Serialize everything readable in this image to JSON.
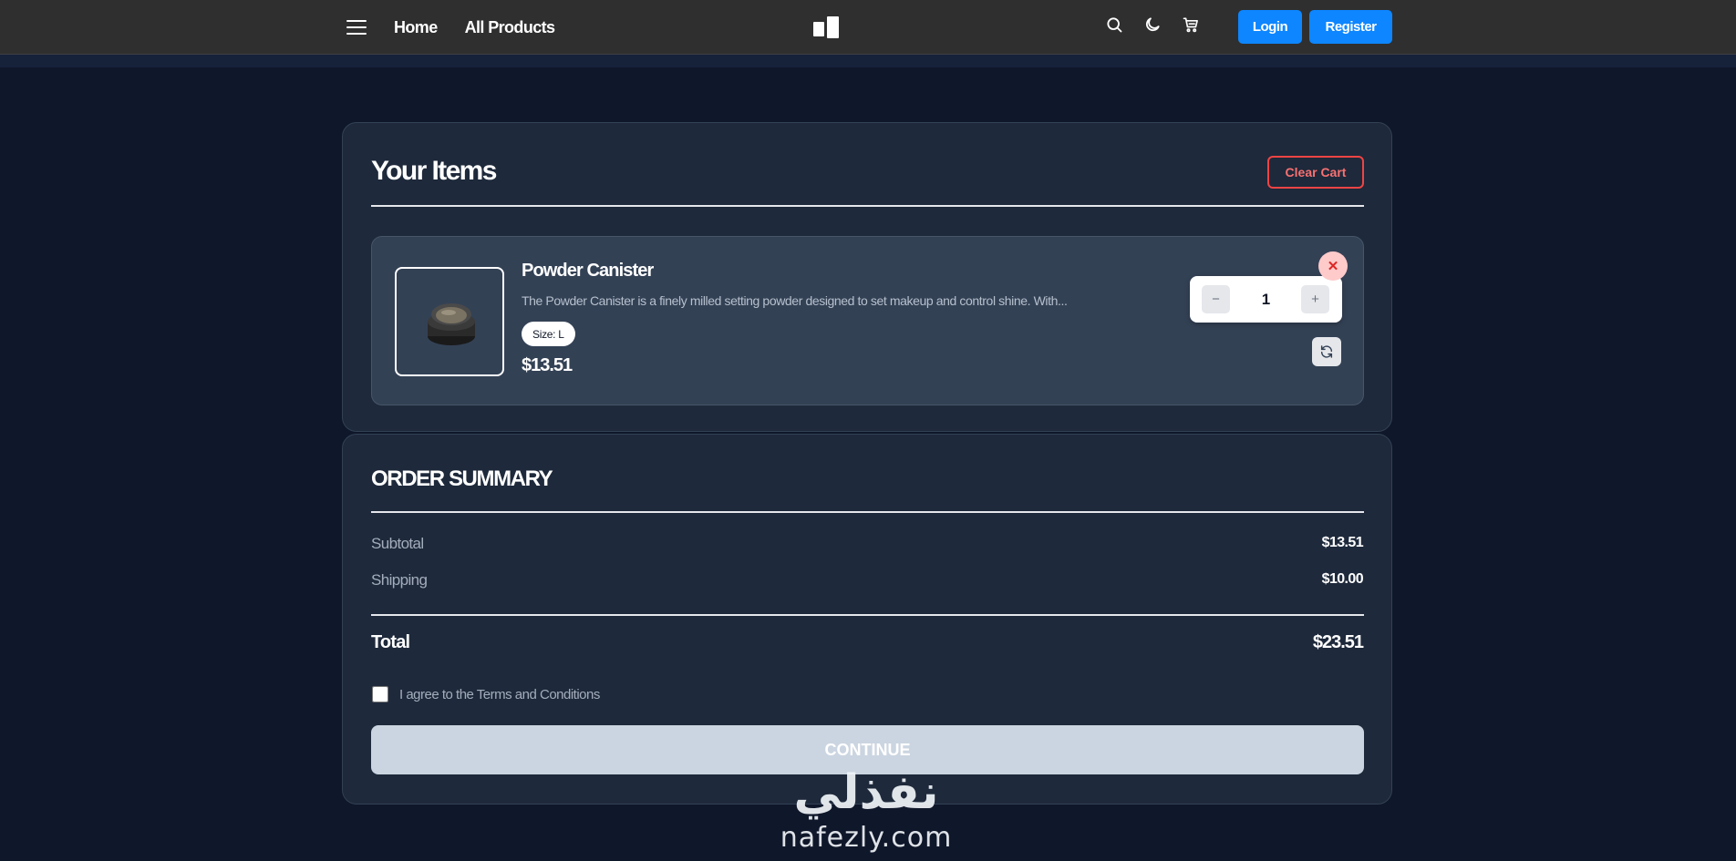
{
  "nav": {
    "home": "Home",
    "all_products": "All Products",
    "login": "Login",
    "register": "Register",
    "icons": [
      "menu-icon",
      "search-icon",
      "moon-icon",
      "cart-icon"
    ]
  },
  "cart": {
    "title": "Your Items",
    "clear_label": "Clear Cart",
    "items": [
      {
        "name": "Powder Canister",
        "description": "The Powder Canister is a finely milled setting powder designed to set makeup and control shine. With...",
        "size": "Size: L",
        "price": "$13.51",
        "quantity": "1",
        "minus": "−",
        "plus": "+",
        "remove": "✕"
      }
    ]
  },
  "summary": {
    "title": "ORDER SUMMARY",
    "subtotal_label": "Subtotal",
    "subtotal_value": "$13.51",
    "shipping_label": "Shipping",
    "shipping_value": "$10.00",
    "total_label": "Total",
    "total_value": "$23.51",
    "terms_label": "I agree to the Terms and Conditions",
    "terms_checked": false,
    "continue_label": "CONTINUE"
  },
  "watermark": {
    "arabic": "نفذلي",
    "latin": "nafezly.com"
  },
  "colors": {
    "page_bg": "#0f172a",
    "navbar_bg": "#2f2f2f",
    "card_bg": "#1e293b",
    "item_bg": "#334155",
    "accent_blue": "#0d86ff",
    "danger_red": "#ef4444",
    "continue_disabled": "#cbd5e1"
  }
}
